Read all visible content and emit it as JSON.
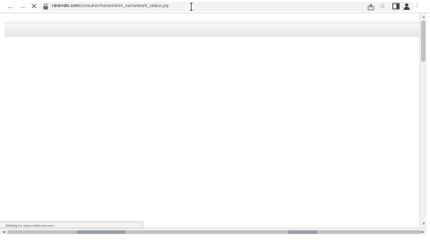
{
  "browser": {
    "url_host": "nintendo.com",
    "url_path": "/consumer/network/en_na/network_status.jsp",
    "status_text": "Waiting for www.nintendo.com...",
    "nav": {
      "back": "←",
      "forward": "→",
      "stop": "✕"
    },
    "icons": {
      "lock": "lock-icon",
      "share": "share-icon",
      "bookmark": "☆",
      "sidebar": "sidebar-icon",
      "profile": "profile-icon",
      "menu": "⋮"
    }
  },
  "scrollbars": {
    "up": "▲",
    "down": "▼",
    "left": "◀",
    "right": "▶"
  }
}
